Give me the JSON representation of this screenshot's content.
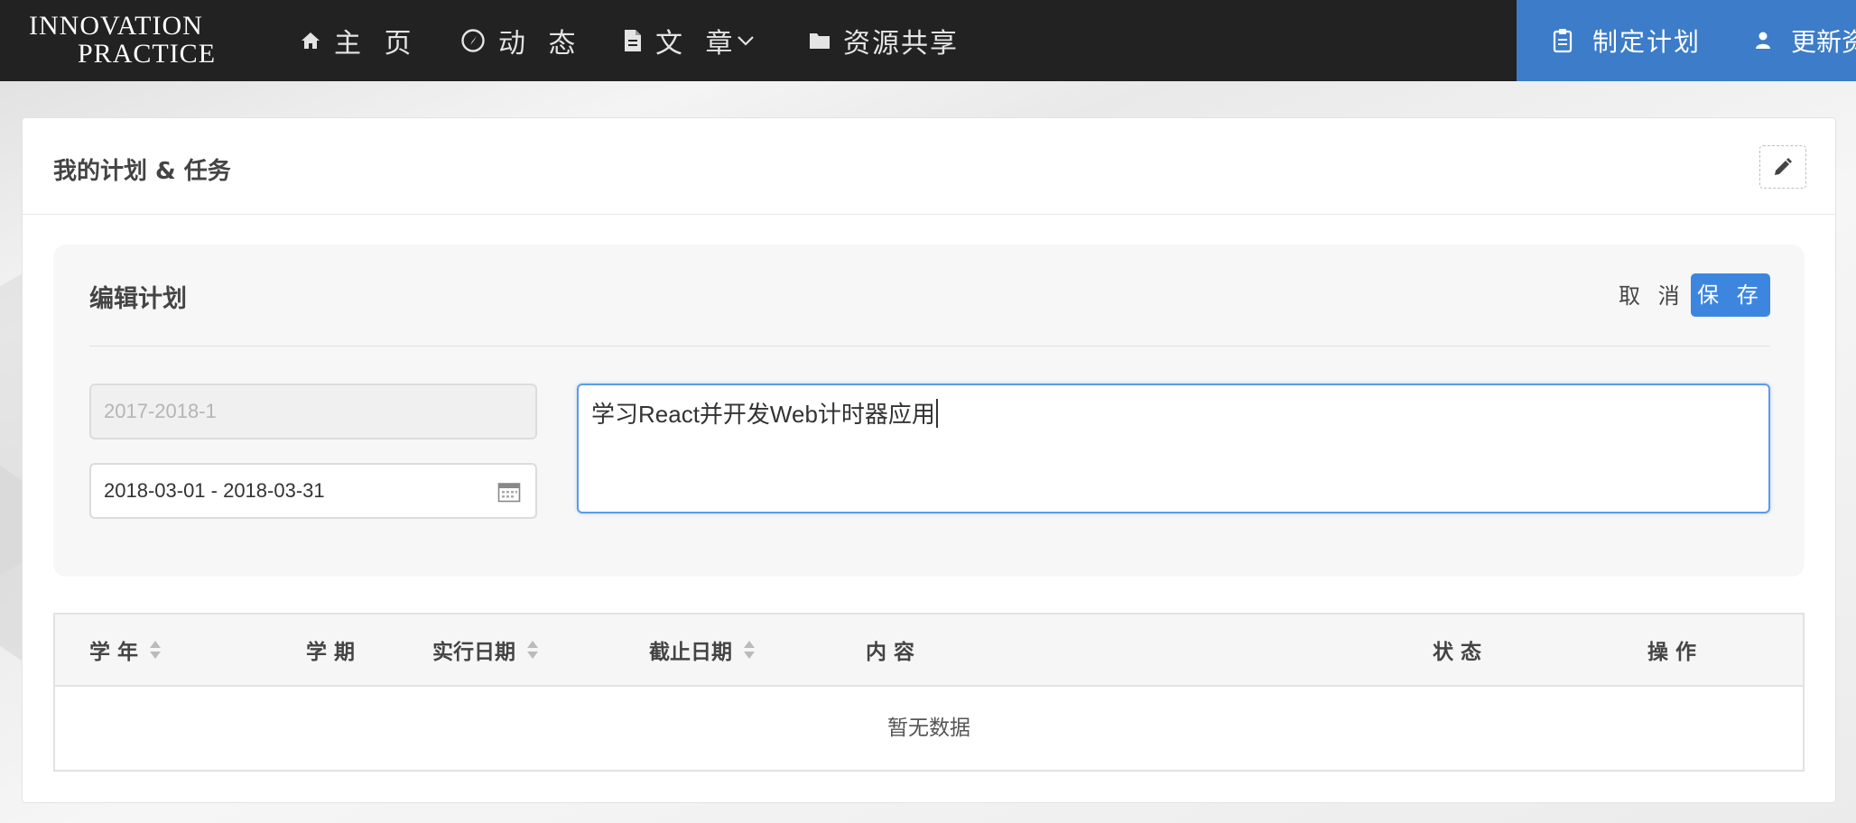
{
  "navbar": {
    "logo_line1": "INNOVATION",
    "logo_line2": "PRACTICE",
    "items": [
      {
        "label": "主 页",
        "icon": "home-icon"
      },
      {
        "label": "动 态",
        "icon": "compass-icon"
      },
      {
        "label": "文 章",
        "icon": "document-icon"
      },
      {
        "label": "资源共享",
        "icon": "folder-icon"
      }
    ],
    "plan_label": "制定计划",
    "update_label": "更新资",
    "right_bg": "#3c7cc8"
  },
  "panel": {
    "title": "我的计划 & 任务",
    "edit_icon": "pencil-icon"
  },
  "edit_form": {
    "title": "编辑计划",
    "cancel_label": "取 消",
    "save_label": "保 存",
    "term_placeholder": "2017-2018-1",
    "date_range_value": "2018-03-01 - 2018-03-31",
    "content_value": "学习React并开发Web计时器应用",
    "accent": "#3d86e0"
  },
  "table": {
    "columns": [
      {
        "label": "学 年",
        "sortable": true
      },
      {
        "label": "学 期",
        "sortable": false
      },
      {
        "label": "实行日期",
        "sortable": true
      },
      {
        "label": "截止日期",
        "sortable": true
      },
      {
        "label": "内 容",
        "sortable": false
      },
      {
        "label": "状 态",
        "sortable": false
      },
      {
        "label": "操 作",
        "sortable": false
      }
    ],
    "empty_text": "暂无数据"
  }
}
